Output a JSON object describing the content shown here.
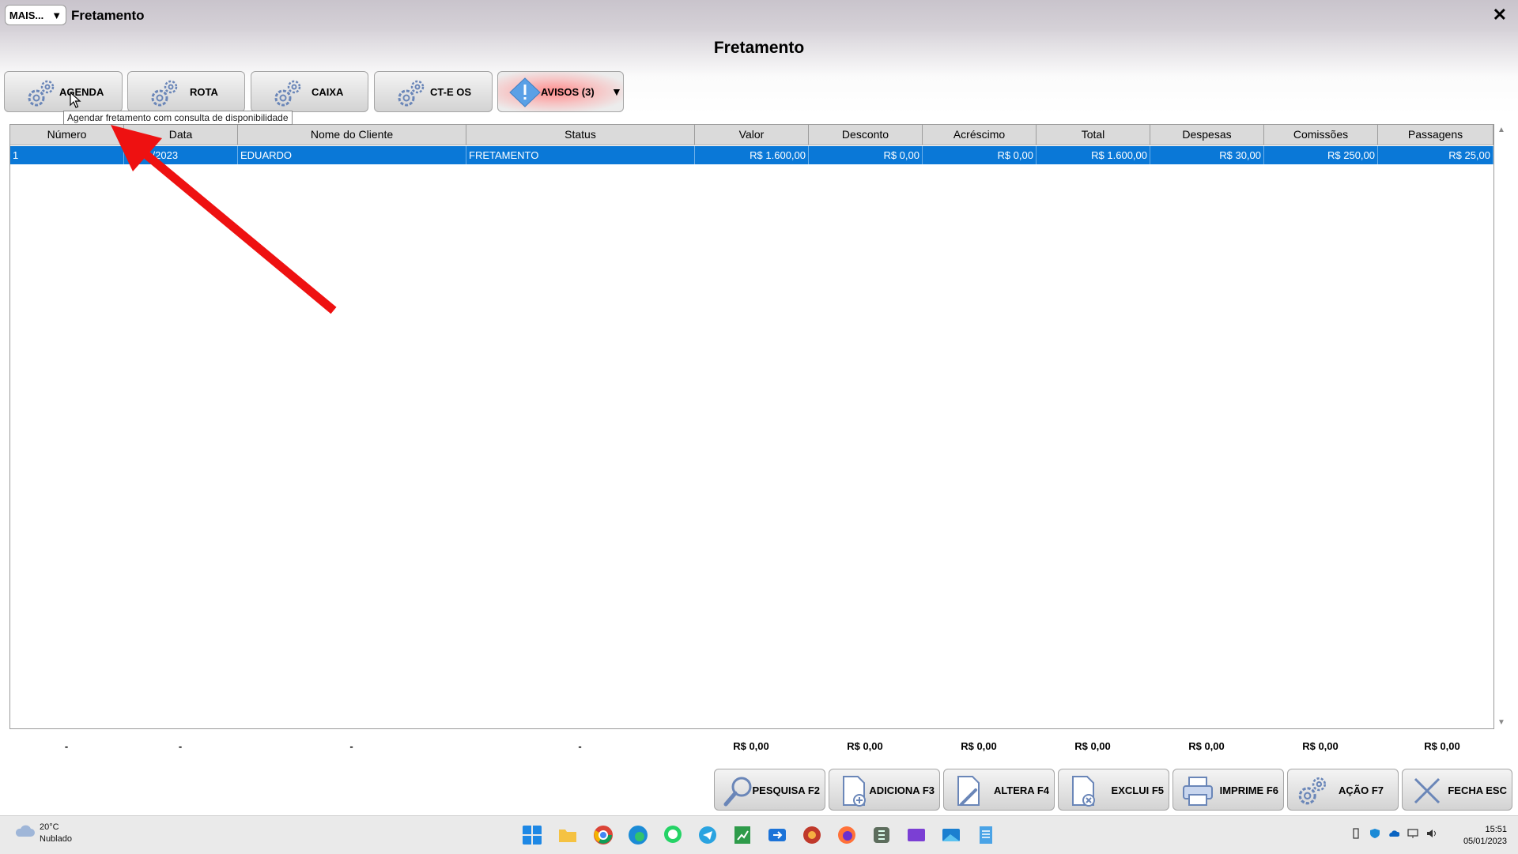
{
  "window": {
    "mais_label": "MAIS...",
    "mais_caret": "▼",
    "title": "Fretamento",
    "close": "✕"
  },
  "page_title": "Fretamento",
  "toolbar": {
    "agenda": "AGENDA",
    "rota": "ROTA",
    "caixa": "CAIXA",
    "cte_os": "CT-E OS",
    "avisos": "AVISOS (3)",
    "avisos_caret": "▼",
    "tooltip": "Agendar fretamento com consulta de disponibilidade"
  },
  "table": {
    "columns": [
      "Número",
      "Data",
      "Nome do Cliente",
      "Status",
      "Valor",
      "Desconto",
      "Acréscimo",
      "Total",
      "Despesas",
      "Comissões",
      "Passagens"
    ],
    "rows": [
      [
        "1",
        "05/01/2023",
        "EDUARDO",
        "FRETAMENTO",
        "R$ 1.600,00",
        "R$ 0,00",
        "R$ 0,00",
        "R$ 1.600,00",
        "R$ 30,00",
        "R$ 250,00",
        "R$ 25,00"
      ]
    ],
    "totals": [
      "-",
      "-",
      "-",
      "-",
      "R$ 0,00",
      "R$ 0,00",
      "R$ 0,00",
      "R$ 0,00",
      "R$ 0,00",
      "R$ 0,00",
      "R$ 0,00"
    ]
  },
  "actions": {
    "pesquisa": "PESQUISA F2",
    "adiciona": "ADICIONA F3",
    "altera": "ALTERA F4",
    "exclui": "EXCLUI F5",
    "imprime": "IMPRIME F6",
    "acao": "AÇÃO F7",
    "fecha": "FECHA ESC"
  },
  "taskbar": {
    "weather_temp": "20°C",
    "weather_cond": "Nublado",
    "time": "15:51",
    "date": "05/01/2023"
  },
  "colors": {
    "selection": "#0a78d7",
    "arrow": "#ee1111",
    "avisos": "#ff8c8c"
  }
}
